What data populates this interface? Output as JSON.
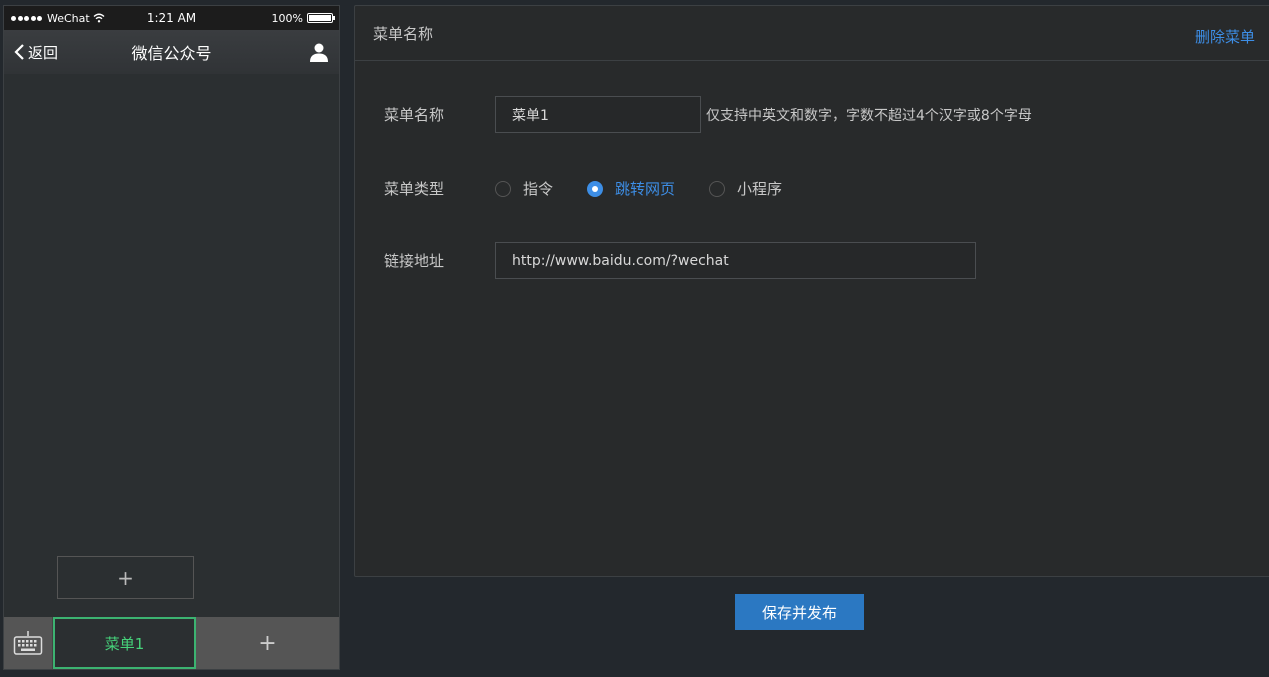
{
  "phone": {
    "status_bar": {
      "carrier": "WeChat",
      "time": "1:21 AM",
      "battery": "100%"
    },
    "nav": {
      "back_label": "返回",
      "title": "微信公众号"
    },
    "submenu_add_label": "+",
    "menu_bar": {
      "active_item": "菜单1",
      "add_label": "+"
    }
  },
  "editor": {
    "header": {
      "title": "菜单名称",
      "delete_label": "删除菜单"
    },
    "name_row": {
      "label": "菜单名称",
      "value": "菜单1",
      "hint": "仅支持中英文和数字，字数不超过4个汉字或8个字母"
    },
    "type_row": {
      "label": "菜单类型",
      "options": [
        {
          "label": "指令",
          "checked": false
        },
        {
          "label": "跳转网页",
          "checked": true
        },
        {
          "label": "小程序",
          "checked": false
        }
      ]
    },
    "url_row": {
      "label": "链接地址",
      "value": "http://www.baidu.com/?wechat"
    }
  },
  "save_label": "保存并发布",
  "colors": {
    "accent": "#3d8ee6",
    "active_green": "#46d27a",
    "primary_button": "#2b78c2"
  }
}
